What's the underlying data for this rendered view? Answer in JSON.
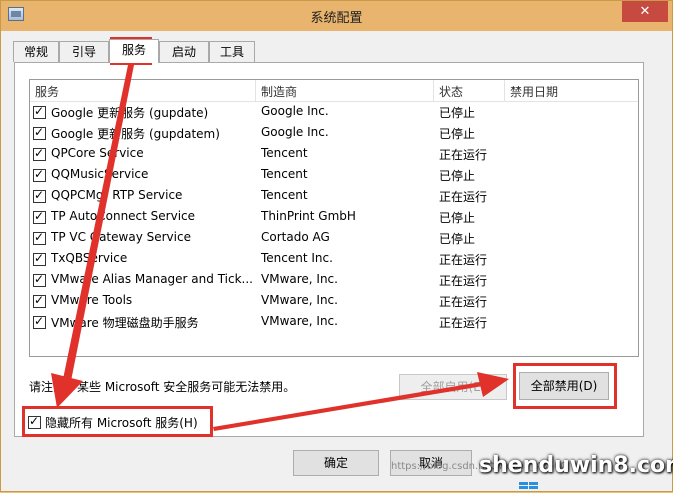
{
  "window": {
    "title": "系统配置",
    "close_glyph": "✕"
  },
  "tabs": [
    {
      "label": "常规"
    },
    {
      "label": "引导"
    },
    {
      "label": "服务"
    },
    {
      "label": "启动"
    },
    {
      "label": "工具"
    }
  ],
  "columns": {
    "service": "服务",
    "manufacturer": "制造商",
    "status": "状态",
    "disable_date": "禁用日期"
  },
  "rows": [
    {
      "service": "Google 更新服务 (gupdate)",
      "manufacturer": "Google Inc.",
      "status": "已停止"
    },
    {
      "service": "Google 更新服务 (gupdatem)",
      "manufacturer": "Google Inc.",
      "status": "已停止"
    },
    {
      "service": "QPCore Service",
      "manufacturer": "Tencent",
      "status": "正在运行"
    },
    {
      "service": "QQMusicService",
      "manufacturer": "Tencent",
      "status": "已停止"
    },
    {
      "service": "QQPCMgr RTP Service",
      "manufacturer": "Tencent",
      "status": "正在运行"
    },
    {
      "service": "TP AutoConnect Service",
      "manufacturer": "ThinPrint GmbH",
      "status": "已停止"
    },
    {
      "service": "TP VC Gateway Service",
      "manufacturer": "Cortado AG",
      "status": "已停止"
    },
    {
      "service": "TxQBService",
      "manufacturer": "Tencent Inc.",
      "status": "正在运行"
    },
    {
      "service": "VMware Alias Manager and Tick...",
      "manufacturer": "VMware, Inc.",
      "status": "正在运行"
    },
    {
      "service": "VMware Tools",
      "manufacturer": "VMware, Inc.",
      "status": "正在运行"
    },
    {
      "service": "VMware 物理磁盘助手服务",
      "manufacturer": "VMware, Inc.",
      "status": "正在运行"
    }
  ],
  "note": "请注意，某些 Microsoft 安全服务可能无法禁用。",
  "buttons": {
    "enable_all": "全部启用(E)",
    "disable_all": "全部禁用(D)",
    "ok": "确定",
    "cancel": "取消"
  },
  "hide_ms_label": "隐藏所有 Microsoft 服务(H)",
  "watermark": {
    "text": "shenduwin8.com",
    "url": "https://blog.csdn.net/weixin_43500"
  },
  "colors": {
    "annotation": "#e0322b",
    "titlebar": "#e9b46d",
    "close": "#c74a40"
  }
}
